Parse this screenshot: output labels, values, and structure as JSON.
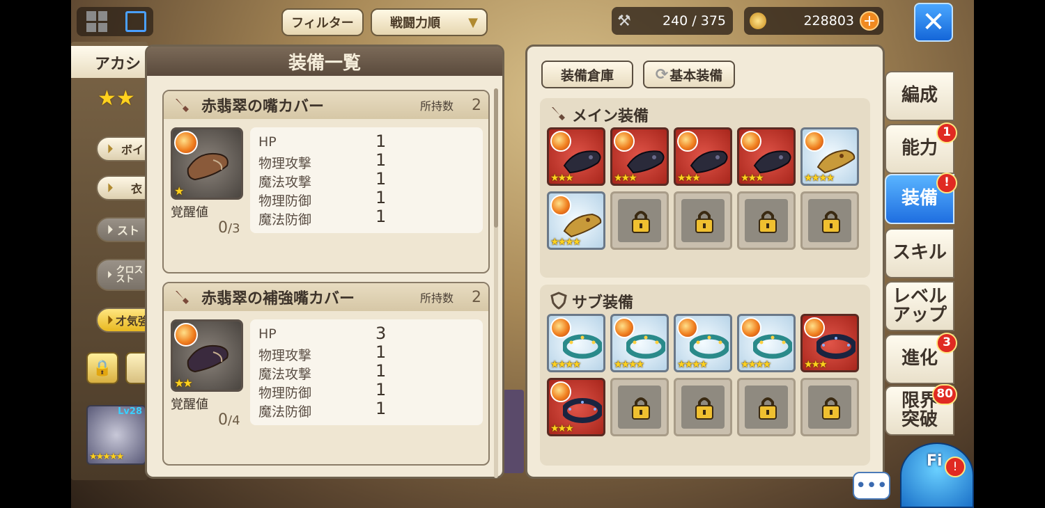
{
  "top_bar": {
    "filter_label": "フィルター",
    "sort_label": "戦闘力順",
    "stamina": "240 / 375",
    "gold": "228803"
  },
  "left_panel": {
    "char_name": "アカシ",
    "buttons": [
      "ボイ",
      "衣",
      "スト",
      "クロス\nスト",
      "才気強"
    ],
    "char_level": "Lv28"
  },
  "equip_list": {
    "title": "装備一覧",
    "items": [
      {
        "name": "赤翡翠の嘴カバー",
        "owned_label": "所持数",
        "owned": "2",
        "stars": "★",
        "awaken_label": "覚醒値",
        "awaken_cur": "0",
        "awaken_max": "/3",
        "stats": [
          {
            "label": "HP",
            "value": "1"
          },
          {
            "label": "物理攻撃",
            "value": "1"
          },
          {
            "label": "魔法攻撃",
            "value": "1"
          },
          {
            "label": "物理防御",
            "value": "1"
          },
          {
            "label": "魔法防御",
            "value": "1"
          }
        ]
      },
      {
        "name": "赤翡翠の補強嘴カバー",
        "owned_label": "所持数",
        "owned": "2",
        "stars": "★★",
        "awaken_label": "覚醒値",
        "awaken_cur": "0",
        "awaken_max": "/4",
        "stats": [
          {
            "label": "HP",
            "value": "3"
          },
          {
            "label": "物理攻撃",
            "value": "1"
          },
          {
            "label": "魔法攻撃",
            "value": "1"
          },
          {
            "label": "物理防御",
            "value": "1"
          },
          {
            "label": "魔法防御",
            "value": "1"
          }
        ]
      }
    ]
  },
  "equip_panel": {
    "storage_label": "装備倉庫",
    "basic_label": "基本装備",
    "main_title": "メイン装備",
    "sub_title": "サブ装備",
    "main_slots": [
      {
        "type": "red",
        "stars": "★★★"
      },
      {
        "type": "red",
        "stars": "★★★"
      },
      {
        "type": "red",
        "stars": "★★★"
      },
      {
        "type": "red",
        "stars": "★★★"
      },
      {
        "type": "blue",
        "stars": "★★★★"
      },
      {
        "type": "blue",
        "stars": "★★★★"
      },
      {
        "type": "lock"
      },
      {
        "type": "lock"
      },
      {
        "type": "lock"
      },
      {
        "type": "lock"
      }
    ],
    "sub_slots": [
      {
        "type": "blue",
        "stars": "★★★★"
      },
      {
        "type": "blue",
        "stars": "★★★★"
      },
      {
        "type": "blue",
        "stars": "★★★★"
      },
      {
        "type": "blue",
        "stars": "★★★★"
      },
      {
        "type": "red",
        "stars": "★★★"
      },
      {
        "type": "red",
        "stars": "★★★"
      },
      {
        "type": "lock"
      },
      {
        "type": "lock"
      },
      {
        "type": "lock"
      },
      {
        "type": "lock"
      }
    ]
  },
  "side_tabs": [
    {
      "label": "編成",
      "badge": ""
    },
    {
      "label": "能力",
      "badge": "1"
    },
    {
      "label": "装備",
      "badge": "!"
    },
    {
      "label": "スキル",
      "badge": ""
    },
    {
      "label": "レベル\nアップ",
      "badge": ""
    },
    {
      "label": "進化",
      "badge": "3"
    },
    {
      "label": "限界\n突破",
      "badge": "80"
    }
  ],
  "chat_label": "•••",
  "fi_label": "Fi"
}
